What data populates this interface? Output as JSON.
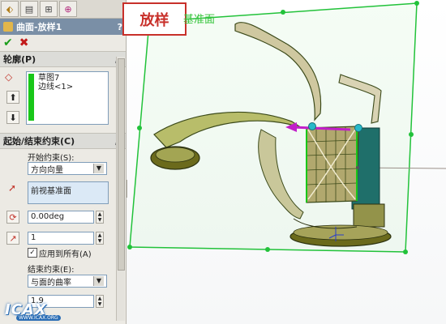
{
  "callout": {
    "text": "放样"
  },
  "plane_label": "基准面",
  "panel": {
    "title": "曲面-放样1",
    "help": "?",
    "profiles": {
      "header": "轮廓(P)",
      "items": [
        "草图7",
        "边线<1>"
      ]
    },
    "constraints": {
      "header": "起始/结束约束(C)",
      "start_label": "开始约束(S):",
      "start_value": "方向向量",
      "direction_field": "前视基准面",
      "angle_value": "0.00deg",
      "length_value": "1",
      "apply_all_label": "应用到所有(A)",
      "end_label": "结束约束(E):",
      "end_value": "与面的曲率",
      "end_number": "1.9"
    }
  },
  "watermark": {
    "text": "ICAX",
    "sub": "WWW.ICAX.ORG"
  },
  "colors": {
    "plane": "#22c23a",
    "callout_border": "#c8302a",
    "model_olive": "#6b6a1c",
    "model_teal": "#1f6f6a",
    "arrow_magenta": "#c21ec9"
  }
}
